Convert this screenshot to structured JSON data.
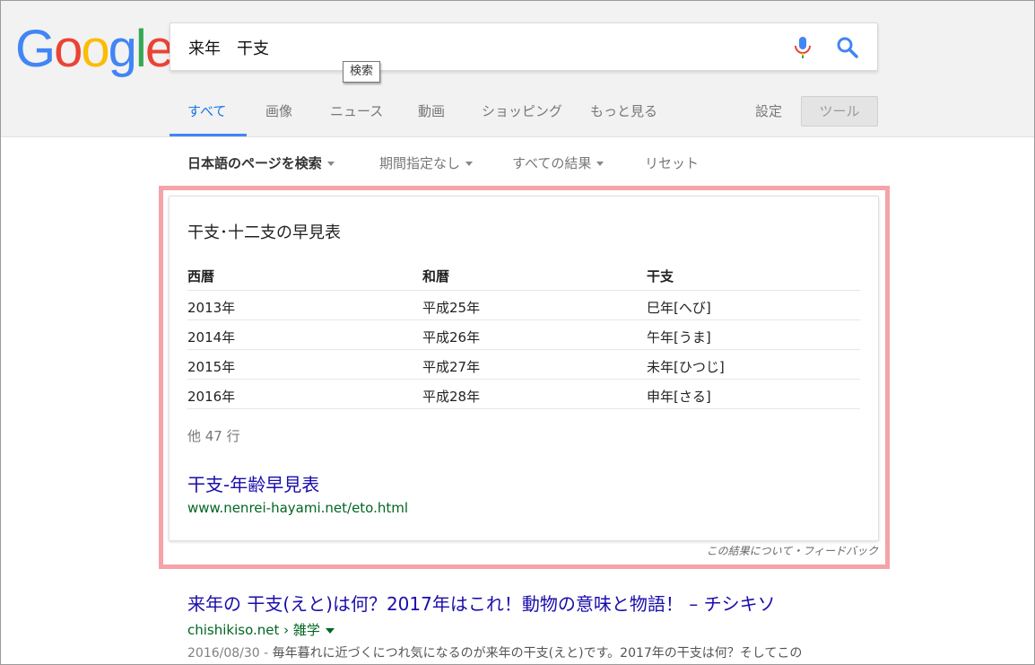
{
  "logo": {
    "letters": [
      "G",
      "o",
      "o",
      "g",
      "l",
      "e"
    ],
    "colors": [
      "#4285F4",
      "#EA4335",
      "#FBBC05",
      "#4285F4",
      "#34A853",
      "#EA4335"
    ]
  },
  "search": {
    "query": "来年　干支",
    "tooltip": "検索"
  },
  "tabs": [
    {
      "label": "すべて",
      "active": true
    },
    {
      "label": "画像"
    },
    {
      "label": "ニュース"
    },
    {
      "label": "動画"
    },
    {
      "label": "ショッピング"
    },
    {
      "label": "もっと見る"
    }
  ],
  "settings_label": "設定",
  "tools_label": "ツール",
  "filters": [
    {
      "label": "日本語のページを検索"
    },
    {
      "label": "期間指定なし"
    },
    {
      "label": "すべての結果"
    },
    {
      "label": "リセット"
    }
  ],
  "featured": {
    "title": "干支･十二支の早見表",
    "columns": [
      "西暦",
      "和暦",
      "干支"
    ],
    "rows": [
      [
        "2013年",
        "平成25年",
        "巳年[へび]"
      ],
      [
        "2014年",
        "平成26年",
        "午年[うま]"
      ],
      [
        "2015年",
        "平成27年",
        "未年[ひつじ]"
      ],
      [
        "2016年",
        "平成28年",
        "申年[さる]"
      ]
    ],
    "more_rows": "他 47 行",
    "link_title": "干支-年齢早見表",
    "link_url": "www.nenrei-hayami.net/eto.html",
    "feedback": "この結果について・フィードバック"
  },
  "result2": {
    "title": "来年の 干支(えと)は何？2017年はこれ！動物の意味と物語！ – チシキソ",
    "url": "chishikiso.net › 雑学",
    "date": "2016/08/30 - ",
    "snippet": "毎年暮れに近づくにつれ気になるのが来年の干支(えと)です。2017年の干支は何？そしてこの"
  },
  "colors": {
    "accent": "#4285F4",
    "link": "#1a0dab",
    "url": "#006621",
    "highlight": "#f5a3a8"
  }
}
